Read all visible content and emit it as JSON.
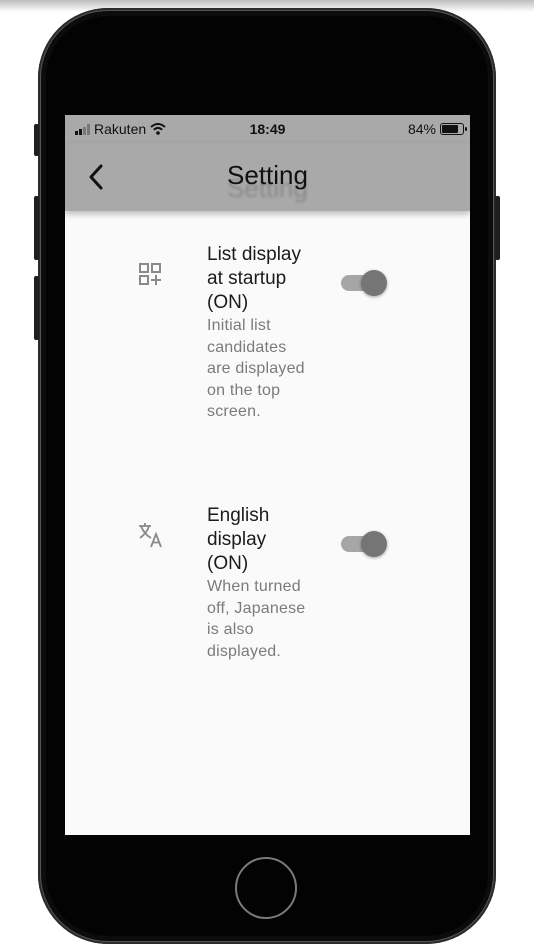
{
  "status_bar": {
    "carrier": "Rakuten",
    "time": "18:49",
    "battery": "84%",
    "battery_level": 0.84
  },
  "header": {
    "title": "Setting",
    "back_icon": "chevron-left-icon"
  },
  "settings": [
    {
      "icon": "list-add-icon",
      "title": "List display at startup (ON)",
      "description": "Initial list candidates are displayed on the top screen.",
      "enabled": true
    },
    {
      "icon": "translate-icon",
      "title": "English display (ON)",
      "description": "When turned off, Japanese is also displayed.",
      "enabled": true
    }
  ],
  "colors": {
    "app_bar": "#a9a9a9",
    "screen_background": "#fafafa",
    "toggle_track": "#a6a6a6",
    "toggle_thumb": "#757575"
  }
}
